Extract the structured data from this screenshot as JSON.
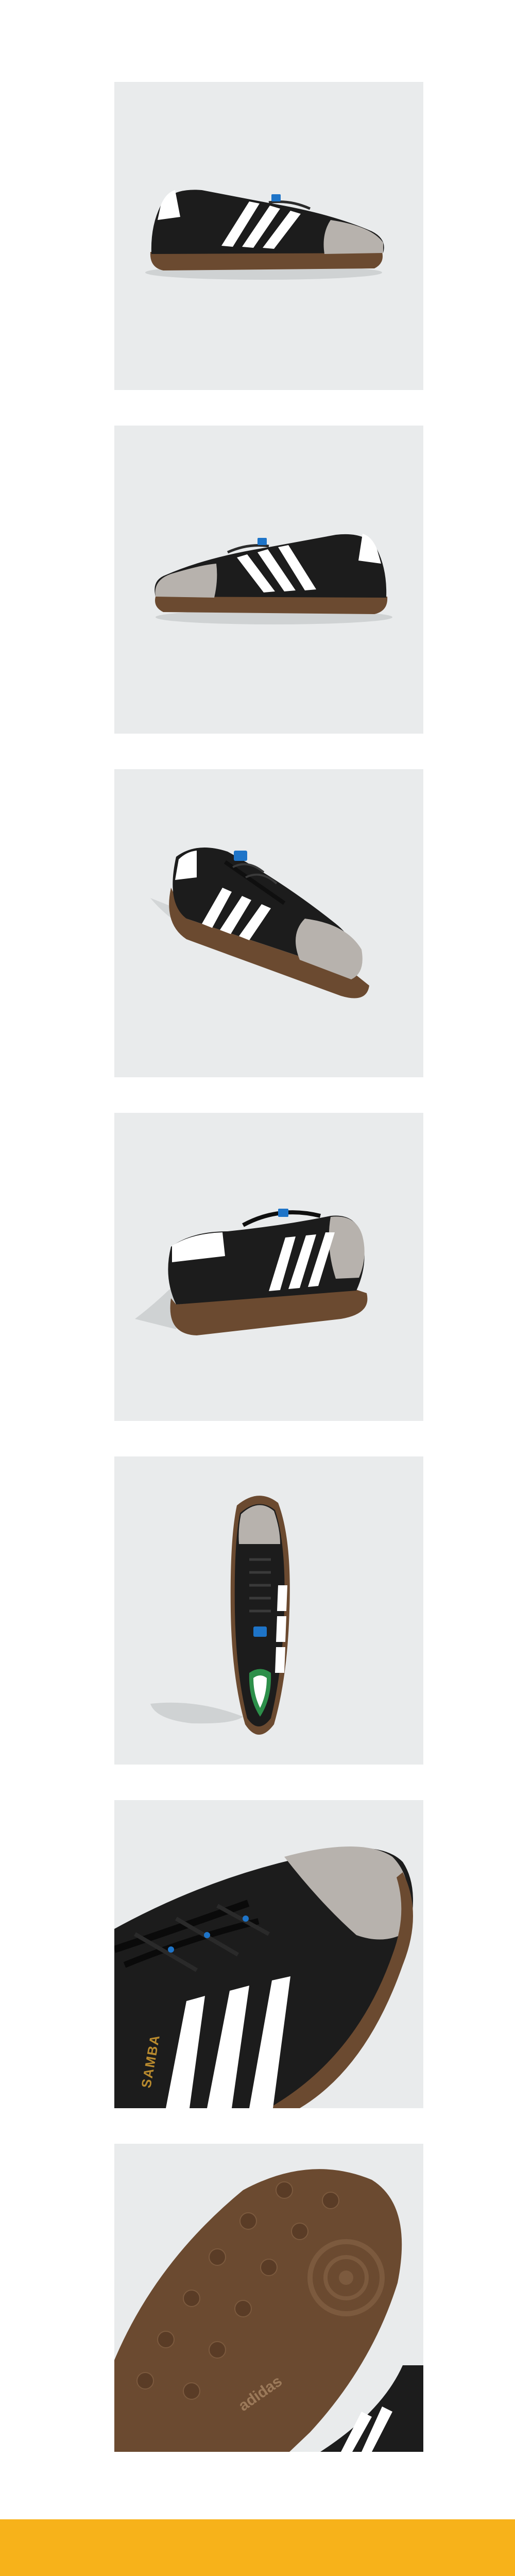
{
  "gallery": {
    "images": [
      {
        "view": "side-lateral"
      },
      {
        "view": "side-medial"
      },
      {
        "view": "front-three-quarter"
      },
      {
        "view": "back-three-quarter"
      },
      {
        "view": "top-down"
      },
      {
        "view": "close-up-stripes"
      },
      {
        "view": "outsole"
      }
    ],
    "panel_background": "#e9ebec"
  },
  "product": {
    "side_print": "SAMBA",
    "outsole_logo": "adidas"
  },
  "colors": {
    "upper": "#1c1c1c",
    "stripes": "#ffffff",
    "suede_toe": "#b7b2ad",
    "gum_sole": "#6b4a30",
    "accent_blue": "#1e74c8",
    "side_print_gold": "#b88a2e",
    "footer_bar": "#f7b21a"
  }
}
